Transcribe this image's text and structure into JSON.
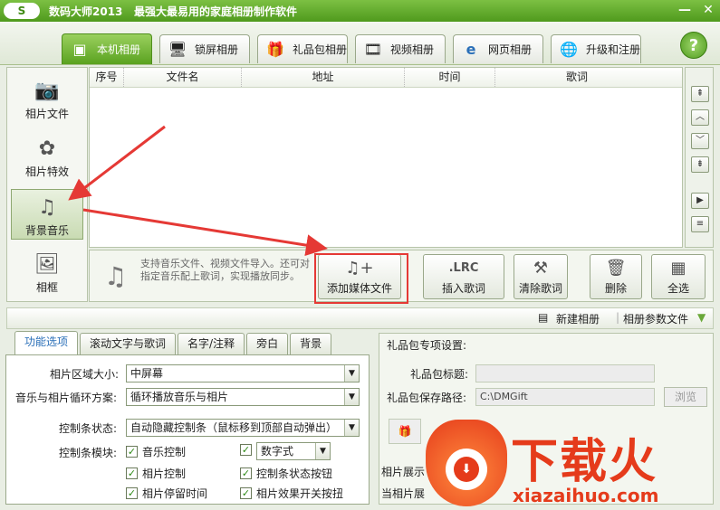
{
  "title_bar": {
    "logo_text": "S",
    "app_name": "数码大师2013",
    "slogan": "最强大最易用的家庭相册制作软件",
    "minimize_glyph": "—",
    "close_glyph": "✕"
  },
  "top_tabs": [
    {
      "label": "本机相册",
      "icon": "photo-album-icon"
    },
    {
      "label": "锁屏相册",
      "icon": "monitor-icon"
    },
    {
      "label": "礼品包相册",
      "icon": "gift-icon"
    },
    {
      "label": "视频相册",
      "icon": "film-icon"
    },
    {
      "label": "网页相册",
      "icon": "ie-icon"
    },
    {
      "label": "升级和注册",
      "icon": "globe-icon"
    }
  ],
  "help_label": "?",
  "sidebar": [
    {
      "label": "相片文件",
      "icon": "camera-icon"
    },
    {
      "label": "相片特效",
      "icon": "effects-icon"
    },
    {
      "label": "背景音乐",
      "icon": "music-note-icon"
    },
    {
      "label": "相框",
      "icon": "frame-icon"
    }
  ],
  "table": {
    "columns": [
      "序号",
      "文件名",
      "地址",
      "时间",
      "歌词"
    ]
  },
  "side_buttons": [
    "⇞",
    "︿",
    "﹀",
    "⇟",
    "▶",
    "≡"
  ],
  "action_row": {
    "hint": "支持音乐文件、视频文件导入。还可对指定音乐配上歌词，实现播放同步。",
    "buttons": [
      {
        "label": "添加媒体文件",
        "icon_text": "♫+"
      },
      {
        "label": "插入歌词",
        "icon_text": ".LRC"
      },
      {
        "label": "清除歌词",
        "icon_text": "⚒"
      },
      {
        "label": "删除",
        "icon_text": "🗑"
      },
      {
        "label": "全选",
        "icon_text": "▦"
      }
    ]
  },
  "toolbar2": {
    "new_album": "新建相册",
    "album_params": "相册参数文件"
  },
  "lower_tabs": [
    "功能选项",
    "滚动文字与歌词",
    "名字/注释",
    "旁白",
    "背景"
  ],
  "options": {
    "area_size_label": "相片区域大小:",
    "area_size_value": "中屏幕",
    "loop_label": "音乐与相片循环方案:",
    "loop_value": "循环播放音乐与相片",
    "control_state_label": "控制条状态:",
    "control_state_value": "自动隐藏控制条（鼠标移到顶部自动弹出）",
    "module_label": "控制条模块:",
    "modules": [
      {
        "label": "音乐控制",
        "checked": true
      },
      {
        "label": "数字式",
        "checked": true,
        "is_select": true
      },
      {
        "label": "相片控制",
        "checked": true
      },
      {
        "label": "控制条状态按钮",
        "checked": true
      },
      {
        "label": "相片停留时间",
        "checked": true
      },
      {
        "label": "相片效果开关按扭",
        "checked": true
      }
    ]
  },
  "gift": {
    "title": "礼品包专项设置:",
    "gift_title_label": "礼品包标题:",
    "gift_title_value": "",
    "save_path_label": "礼品包保存路径:",
    "save_path_value": "C:\\DMGift",
    "browse_label": "浏览",
    "display_label_1": "相片展示",
    "display_label_2": "当相片展"
  },
  "watermark": {
    "big_text": "下载火",
    "url": "xiazaihuo.com"
  },
  "colors": {
    "accent_green": "#5aa21f",
    "highlight_red": "#e53935"
  }
}
